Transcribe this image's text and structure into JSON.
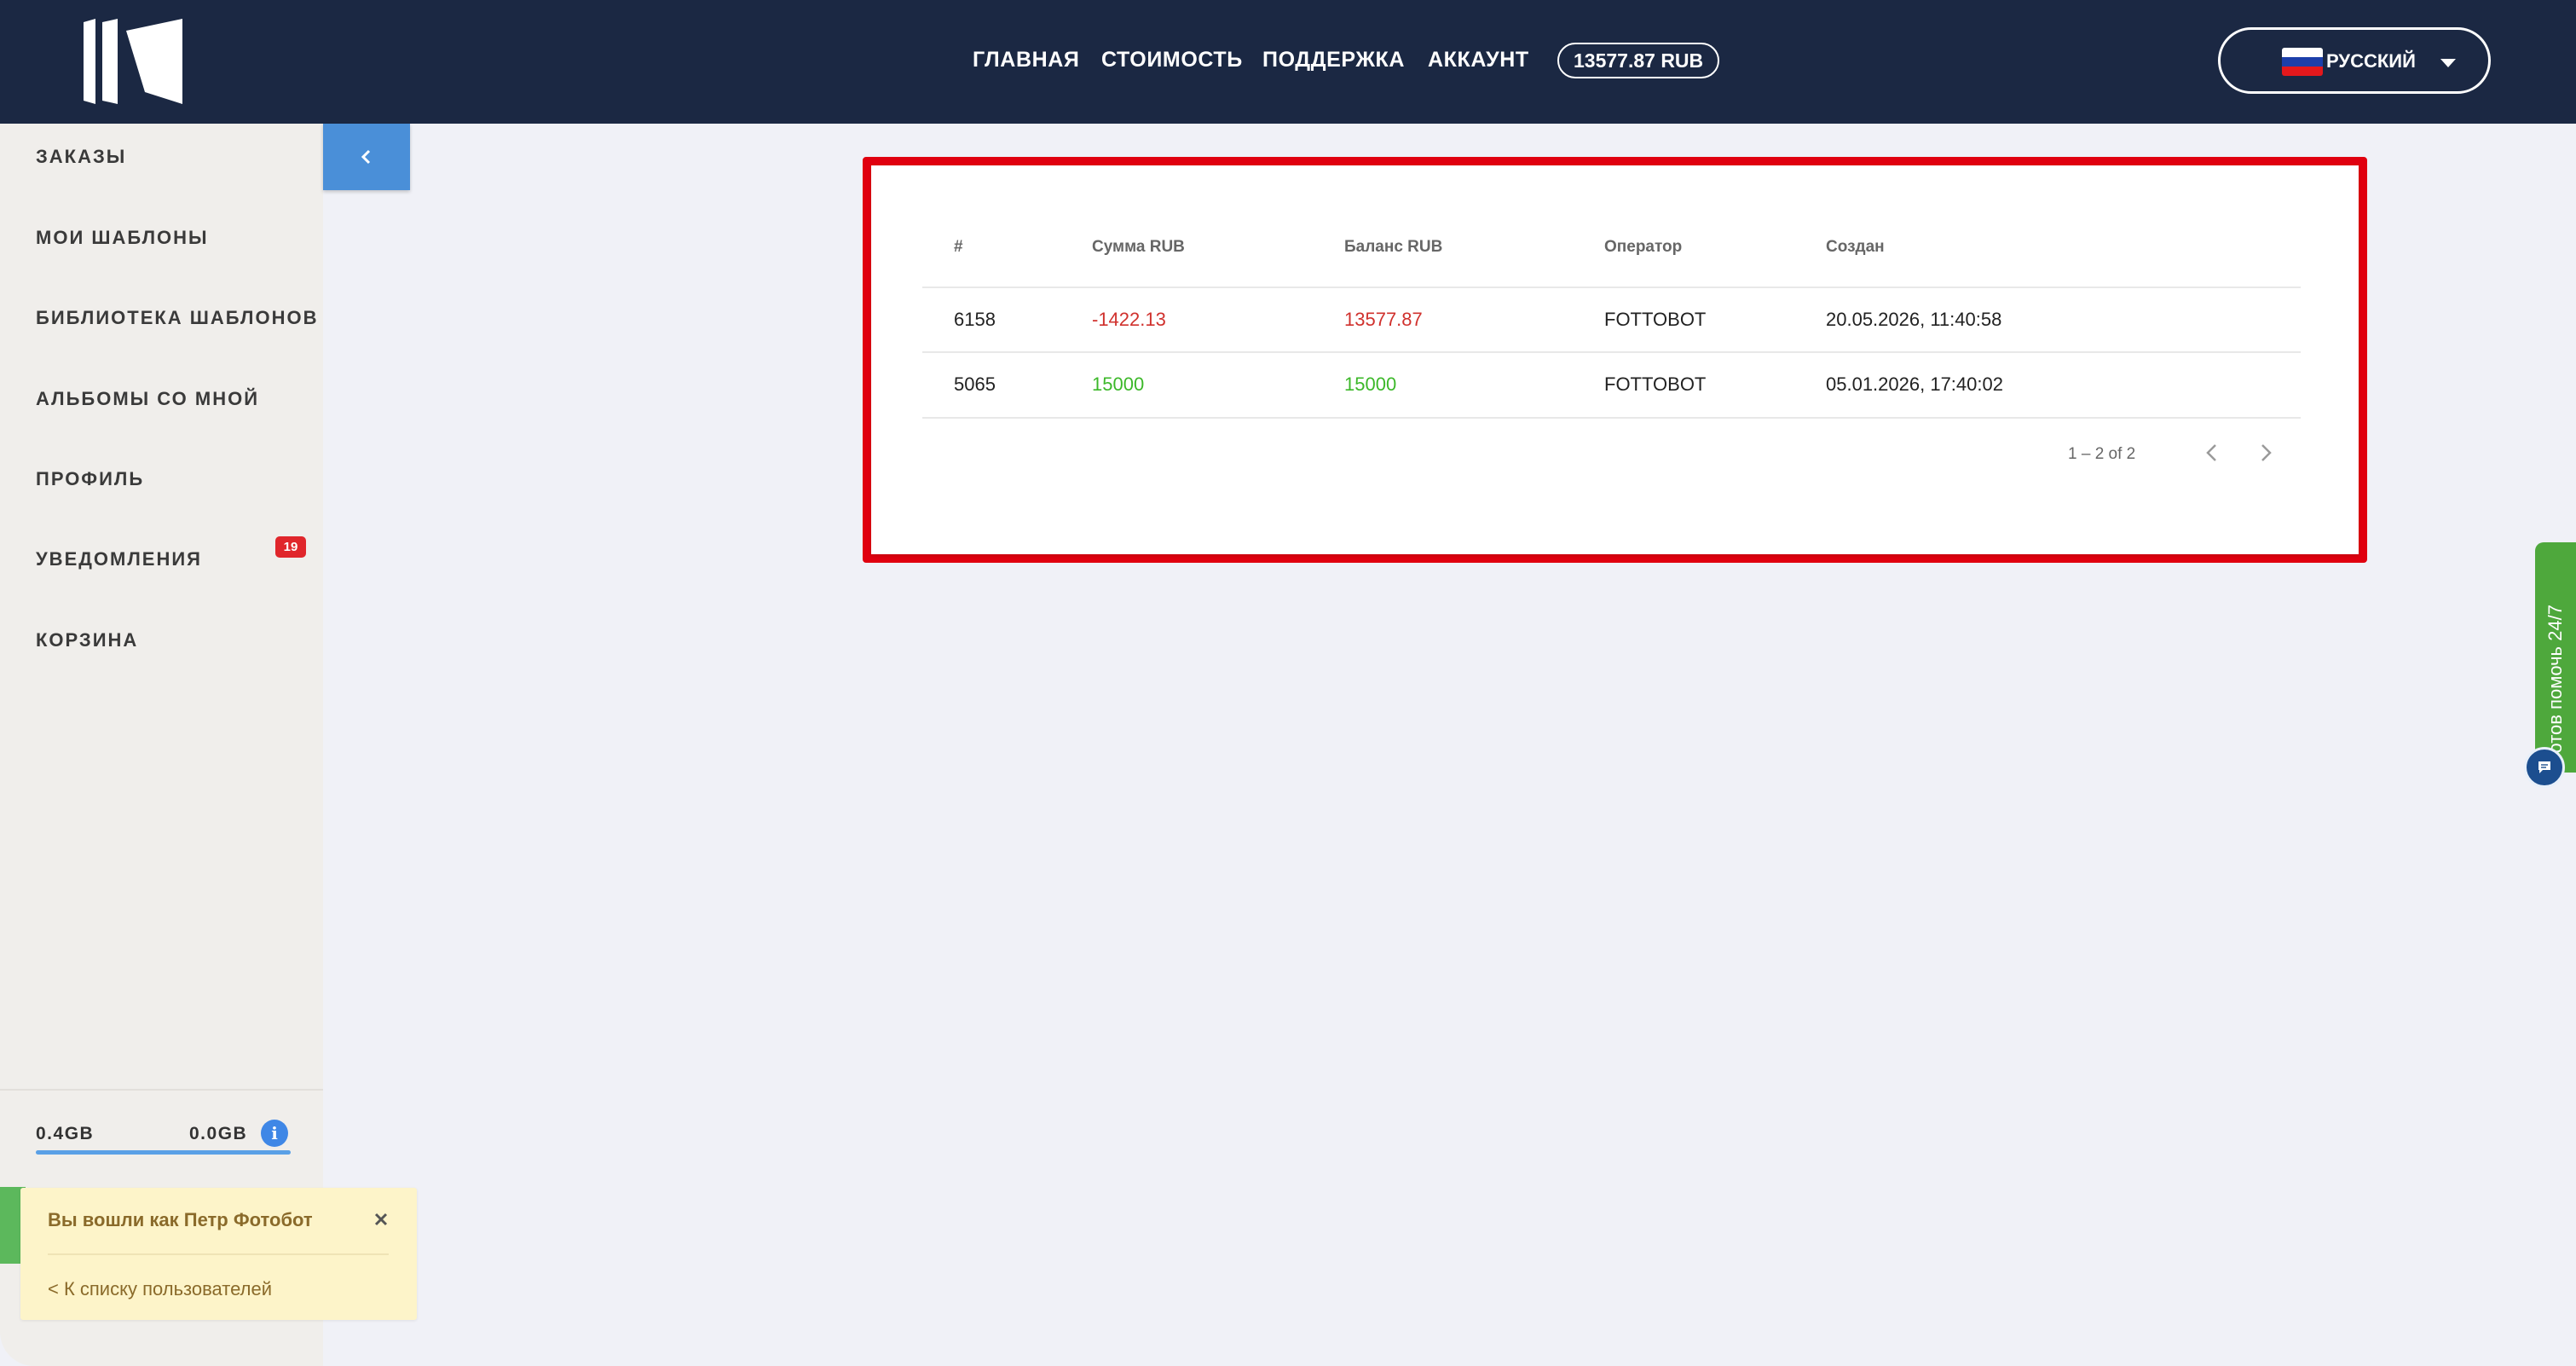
{
  "header": {
    "nav": [
      {
        "label": "ГЛАВНАЯ"
      },
      {
        "label": "СТОИМОСТЬ"
      },
      {
        "label": "ПОДДЕРЖКА"
      },
      {
        "label": "АККАУНТ"
      }
    ],
    "balance": "13577.87 RUB",
    "language": {
      "label": "РУССКИЙ",
      "flag_colors": [
        "#ffffff",
        "#1c3faa",
        "#e4181c"
      ]
    },
    "background_color": "#1b2843"
  },
  "sidebar": {
    "items": [
      {
        "label": "ЗАКАЗЫ"
      },
      {
        "label": "МОИ ШАБЛОНЫ"
      },
      {
        "label": "БИБЛИОТЕКА ШАБЛОНОВ"
      },
      {
        "label": "АЛЬБОМЫ СО МНОЙ"
      },
      {
        "label": "ПРОФИЛЬ"
      },
      {
        "label": "УВЕДОМЛЕНИЯ",
        "badge": "19"
      },
      {
        "label": "КОРЗИНА"
      }
    ],
    "storage": {
      "used": "0.4GB",
      "free": "0.0GB",
      "info_icon": "info-icon",
      "fill_fraction": 1.0
    }
  },
  "collapse_icon": "chevron-left-icon",
  "transactions": {
    "columns": [
      "#",
      "Сумма RUB",
      "Баланс RUB",
      "Оператор",
      "Создан"
    ],
    "rows": [
      {
        "id": "6158",
        "amount": "-1422.13",
        "balance": "13577.87",
        "operator": "FOTTOBOT",
        "created": "20.05.2026, 11:40:58"
      },
      {
        "id": "5065",
        "amount": "15000",
        "balance": "15000",
        "operator": "FOTTOBOT",
        "created": "05.01.2026, 17:40:02"
      }
    ],
    "pagination": "1 – 2 of 2",
    "highlight_color": "#e0000f",
    "negative_color": "#d0312d",
    "positive_color": "#3cb829"
  },
  "help_widget": {
    "label": "Готов помочь 24/7",
    "chat_icon": "chat-bubble-icon",
    "color": "#4ea83c"
  },
  "toast": {
    "title": "Вы вошли как Петр Фотобот",
    "link": "< К списку пользователей",
    "close_icon": "close-icon"
  }
}
